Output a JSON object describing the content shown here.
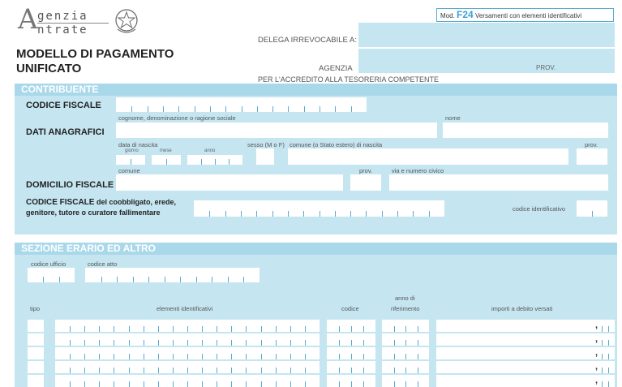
{
  "header": {
    "logo_line1": "genzia",
    "logo_line2": "ntrate",
    "logo_letter": "A",
    "model_title": "MODELLO DI PAGAMENTO UNIFICATO",
    "delega_label": "DELEGA IRREVOCABILE A:",
    "agenzia_label": "AGENZIA",
    "prov_label": "PROV.",
    "accredito_label": "PER L'ACCREDITO ALLA TESORERIA COMPETENTE",
    "mod_prefix": "Mod.",
    "mod_code": "F24",
    "mod_desc": "Versamenti con elementi identificativi"
  },
  "contribuente": {
    "section_title": "CONTRIBUENTE",
    "codice_fiscale_label": "CODICE FISCALE",
    "dati_anagrafici_label": "DATI ANAGRAFICI",
    "cognome_label": "cognome, denominazione o ragione sociale",
    "nome_label": "nome",
    "data_nascita_label": "data di nascita",
    "giorno_label": "giorno",
    "mese_label": "mese",
    "anno_label": "anno",
    "sesso_label": "sesso (M o F)",
    "comune_nascita_label": "comune (o Stato estero) di nascita",
    "prov_label": "prov.",
    "domicilio_label": "DOMICILIO FISCALE",
    "comune_label": "comune",
    "prov2_label": "prov.",
    "via_label": "via e numero civico",
    "coobbligato_label_bold": "CODICE FISCALE",
    "coobbligato_label_rest": "del coobbligato, erede,",
    "coobbligato_label_line2": "genitore, tutore o curatore fallimentare",
    "codice_identificativo_label": "codice identificativo"
  },
  "erario": {
    "section_title": "SEZIONE ERARIO ED ALTRO",
    "codice_ufficio_label": "codice ufficio",
    "codice_atto_label": "codice atto",
    "tipo_label": "tipo",
    "elementi_label": "elementi identificativi",
    "codice_label": "codice",
    "anno_label_1": "anno di",
    "anno_label_2": "riferimento",
    "importi_label": "importi a debito versati",
    "decimal_sep": ","
  }
}
